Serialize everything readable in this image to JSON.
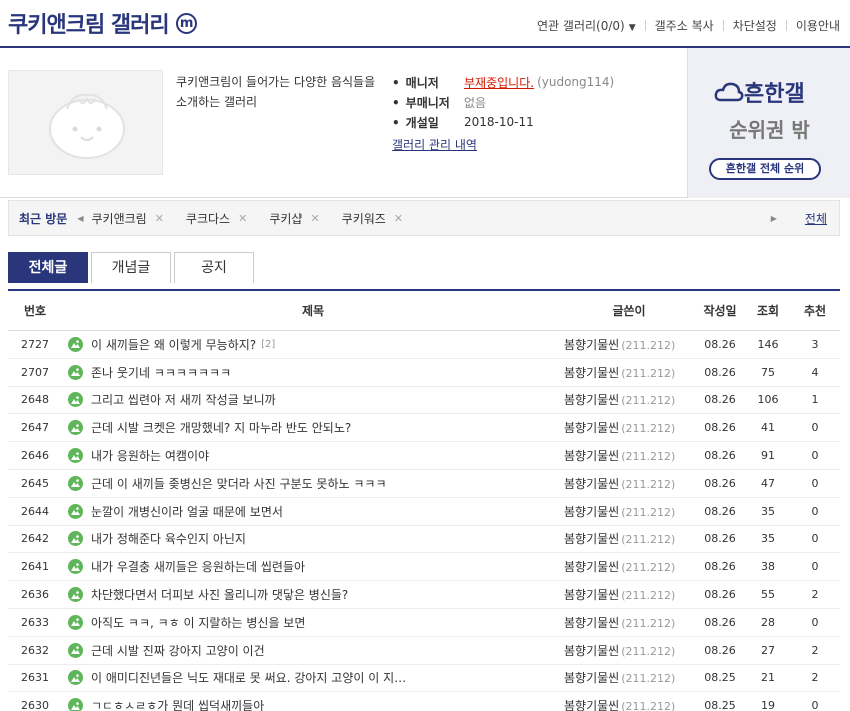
{
  "header": {
    "title": "쿠키앤크림 갤러리",
    "badge": "m",
    "nav": [
      "연관 갤러리(0/0)",
      "갤주소 복사",
      "차단설정",
      "이용안내"
    ]
  },
  "info": {
    "description": "쿠키앤크림이 들어가는 다양한 음식들을 소개하는 갤러리",
    "manager_label": "매니저",
    "manager_value": "부재중입니다.",
    "manager_id": "(yudong114)",
    "submanager_label": "부매니저",
    "submanager_value": "없음",
    "opened_label": "개설일",
    "opened_value": "2018-10-11",
    "history_link": "갤러리 관리 내역"
  },
  "rank": {
    "logo": "흔한갤",
    "status": "순위권 밖",
    "button": "흔한갤 전체 순위"
  },
  "recent": {
    "label": "최근 방문",
    "items": [
      "쿠키앤크림",
      "쿠크다스",
      "쿠키샵",
      "쿠키워즈"
    ],
    "all_link": "전체"
  },
  "tabs": [
    "전체글",
    "개념글",
    "공지"
  ],
  "table": {
    "headers": {
      "num": "번호",
      "title": "제목",
      "writer": "글쓴이",
      "date": "작성일",
      "views": "조회",
      "rec": "추천"
    },
    "rows": [
      {
        "num": "2727",
        "title": "이 새끼들은 왜 이렇게 무능하지?",
        "comments": "[2]",
        "writer": "봄향기물씬",
        "ip": "(211.212)",
        "date": "08.26",
        "views": "146",
        "rec": "3"
      },
      {
        "num": "2707",
        "title": "존나 웃기네 ㅋㅋㅋㅋㅋㅋㅋ",
        "comments": "",
        "writer": "봄향기물씬",
        "ip": "(211.212)",
        "date": "08.26",
        "views": "75",
        "rec": "4"
      },
      {
        "num": "2648",
        "title": "그리고 씹련아 저 새끼 작성글 보니까",
        "comments": "",
        "writer": "봄향기물씬",
        "ip": "(211.212)",
        "date": "08.26",
        "views": "106",
        "rec": "1"
      },
      {
        "num": "2647",
        "title": "근데 시발 크켓은 개망했네? 지 마누라 반도 안되노?",
        "comments": "",
        "writer": "봄향기물씬",
        "ip": "(211.212)",
        "date": "08.26",
        "views": "41",
        "rec": "0"
      },
      {
        "num": "2646",
        "title": "내가 응원하는 여캠이야",
        "comments": "",
        "writer": "봄향기물씬",
        "ip": "(211.212)",
        "date": "08.26",
        "views": "91",
        "rec": "0"
      },
      {
        "num": "2645",
        "title": "근데 이 새끼들 좆병신은 맞더라 사진 구분도 못하노 ㅋㅋㅋ",
        "comments": "",
        "writer": "봄향기물씬",
        "ip": "(211.212)",
        "date": "08.26",
        "views": "47",
        "rec": "0"
      },
      {
        "num": "2644",
        "title": "눈깔이 개병신이라 얼굴 때문에 보면서",
        "comments": "",
        "writer": "봄향기물씬",
        "ip": "(211.212)",
        "date": "08.26",
        "views": "35",
        "rec": "0"
      },
      {
        "num": "2642",
        "title": "내가 정해준다 육수인지 아닌지",
        "comments": "",
        "writer": "봄향기물씬",
        "ip": "(211.212)",
        "date": "08.26",
        "views": "35",
        "rec": "0"
      },
      {
        "num": "2641",
        "title": "내가 우결충 새끼들은 응원하는데 씹련들아",
        "comments": "",
        "writer": "봄향기물씬",
        "ip": "(211.212)",
        "date": "08.26",
        "views": "38",
        "rec": "0"
      },
      {
        "num": "2636",
        "title": "차단했다면서 더피보 사진 올리니까 댓닿은 병신들?",
        "comments": "",
        "writer": "봄향기물씬",
        "ip": "(211.212)",
        "date": "08.26",
        "views": "55",
        "rec": "2"
      },
      {
        "num": "2633",
        "title": "아직도 ㅋㅋ, ㅋㅎ 이 지랄하는 병신을 보면",
        "comments": "",
        "writer": "봄향기물씬",
        "ip": "(211.212)",
        "date": "08.26",
        "views": "28",
        "rec": "0"
      },
      {
        "num": "2632",
        "title": "근데 시발 진짜 강아지 고양이 이건",
        "comments": "",
        "writer": "봄향기물씬",
        "ip": "(211.212)",
        "date": "08.26",
        "views": "27",
        "rec": "2"
      },
      {
        "num": "2631",
        "title": "이 애미디진년들은 닉도 재대로 못 써요. 강아지 고양이 이 지…",
        "comments": "",
        "writer": "봄향기물씬",
        "ip": "(211.212)",
        "date": "08.25",
        "views": "21",
        "rec": "2"
      },
      {
        "num": "2630",
        "title": "ㄱㄷㅎㅅㄹㅎ가 뭔데 씹덕새끼들아",
        "comments": "",
        "writer": "봄향기물씬",
        "ip": "(211.212)",
        "date": "08.25",
        "views": "19",
        "rec": "0"
      }
    ]
  }
}
